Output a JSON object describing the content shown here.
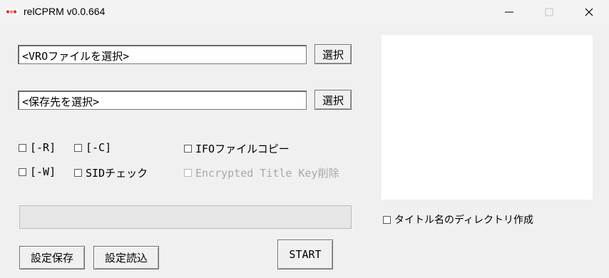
{
  "window": {
    "title": "relCPRM v0.0.664",
    "app_icon": "app-logo-icon"
  },
  "window_controls": {
    "minimize": "minimize-icon",
    "maximize": "maximize-icon",
    "close": "close-icon"
  },
  "source": {
    "path_text": "<VROファイルを選択>",
    "select_label": "選択"
  },
  "destination": {
    "path_text": "<保存先を選択>",
    "select_label": "選択"
  },
  "options": {
    "r": "[-R]",
    "c": "[-C]",
    "ifo_copy": "IFOファイルコピー",
    "w": "[-W]",
    "sid_check": "SIDチェック",
    "encrypted_title_key": "Encrypted Title Key削除",
    "title_dir": "タイトル名のディレクトリ作成"
  },
  "progress": {
    "value": 0
  },
  "buttons": {
    "save_settings": "設定保存",
    "load_settings": "設定読込",
    "start": "START"
  }
}
